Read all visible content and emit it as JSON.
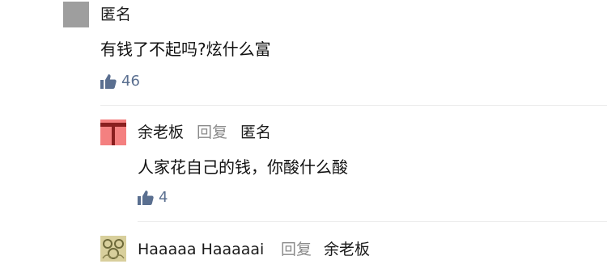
{
  "comments": [
    {
      "author": "匿名",
      "text": "有钱了不起吗?炫什么富",
      "likes": "46"
    }
  ],
  "replies": [
    {
      "author": "余老板",
      "reply_label": "回复",
      "reply_to": "匿名",
      "text": "人家花自己的钱，你酸什么酸",
      "likes": "4"
    },
    {
      "author": "Haaaaa Haaaaai",
      "reply_label": "回复",
      "reply_to": "余老板"
    }
  ],
  "icons": {
    "like": "thumbs-up-icon"
  },
  "colors": {
    "like": "#5a6f90",
    "reply_label": "#8a8a8a",
    "avatar_gray": "#9e9e9e",
    "avatar_red": "#f48080"
  }
}
